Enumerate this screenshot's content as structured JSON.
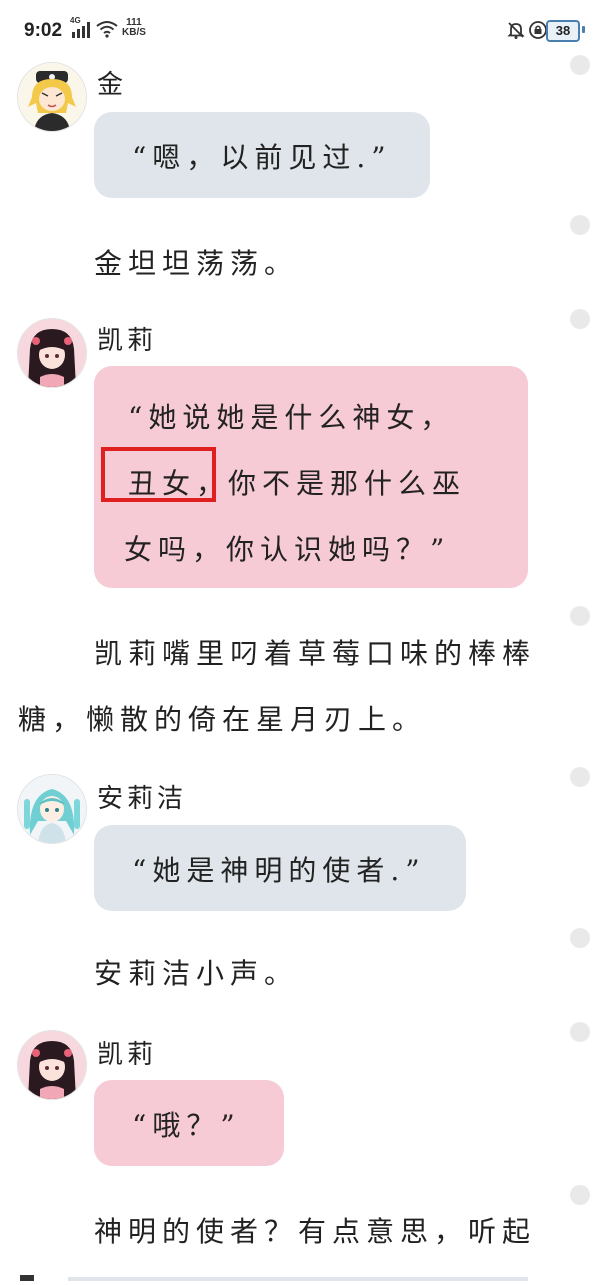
{
  "status_bar": {
    "time": "9:02",
    "network": "4G",
    "net_speed_value": "111",
    "net_speed_unit": "KB/S",
    "battery": "38"
  },
  "messages": [
    {
      "type": "chat",
      "speaker": "金",
      "avatar": "avatar-blonde",
      "bubble": "blue",
      "text": "“嗯，以前见过.”"
    },
    {
      "type": "narration",
      "text": "金坦坦荡荡。"
    },
    {
      "type": "chat",
      "speaker": "凯莉",
      "avatar": "avatar-black-hair",
      "bubble": "pink",
      "lines": [
        "“她说她是什么神女，",
        "丑女，",
        "你不是那什么巫",
        "女吗，你认识她吗？”"
      ]
    },
    {
      "type": "narration",
      "lines": [
        "凯莉嘴里叼着草莓口味的棒棒",
        "糖，懒散的倚在星月刃上。"
      ]
    },
    {
      "type": "chat",
      "speaker": "安莉洁",
      "avatar": "avatar-teal-hair",
      "bubble": "blue",
      "text": "“她是神明的使者.”"
    },
    {
      "type": "narration",
      "text": "安莉洁小声。"
    },
    {
      "type": "chat",
      "speaker": "凯莉",
      "avatar": "avatar-black-hair",
      "bubble": "pink",
      "text": "“哦？”"
    },
    {
      "type": "narration",
      "text": "神明的使者？有点意思，听起"
    }
  ],
  "highlight_text": "丑女，",
  "colors": {
    "blue_bubble": "#dfe5ea",
    "pink_bubble": "#f7cbd5",
    "highlight_border": "#e02020"
  }
}
